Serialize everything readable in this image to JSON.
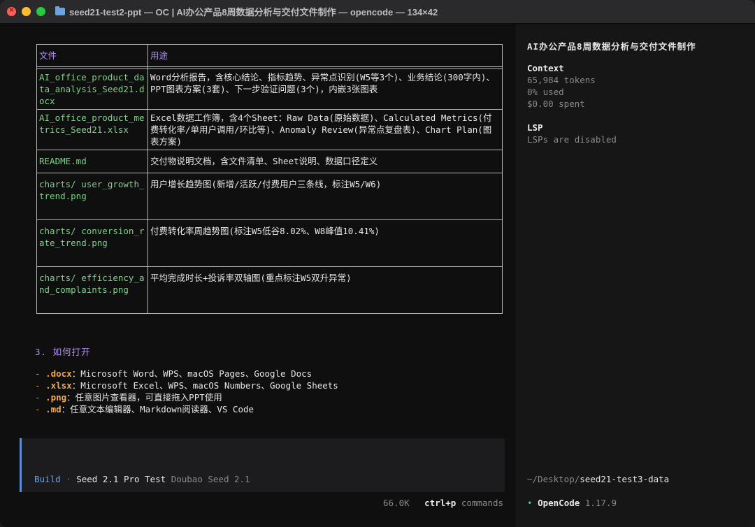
{
  "window": {
    "title": "seed21-test2-ppt — OC | AI办公产品8周数据分析与交付文件制作 — opencode — 134×42"
  },
  "table": {
    "headers": [
      "文件",
      "用途"
    ],
    "rows": [
      {
        "file": "AI_office_product_data_analysis_Seed21.docx",
        "purpose": "Word分析报告，含核心结论、指标趋势、异常点识别(W5等3个)、业务结论(300字内)、PPT图表方案(3套)、下一步验证问题(3个)，内嵌3张图表"
      },
      {
        "file": "AI_office_product_metrics_Seed21.xlsx",
        "purpose": "Excel数据工作簿，含4个Sheet：Raw Data(原始数据)、Calculated Metrics(付费转化率/单用户调用/环比等)、Anomaly Review(异常点复盘表)、Chart Plan(图表方案)"
      },
      {
        "file": "README.md",
        "purpose": "交付物说明文档，含文件清单、Sheet说明、数据口径定义"
      },
      {
        "file": "charts/ user_growth_trend.png",
        "purpose": "用户增长趋势图(新增/活跃/付费用户三条线，标注W5/W6)"
      },
      {
        "file": "charts/ conversion_rate_trend.png",
        "purpose": "付费转化率周趋势图(标注W5低谷8.02%、W8峰值10.41%)"
      },
      {
        "file": "charts/ efficiency_and_complaints.png",
        "purpose": "平均完成时长+投诉率双轴图(重点标注W5双升异常)"
      }
    ]
  },
  "section": {
    "heading": "3. 如何打开"
  },
  "open_list": [
    {
      "dash": "-",
      "ext": ".docx",
      "text": "：Microsoft Word、WPS、macOS Pages、Google Docs"
    },
    {
      "dash": "-",
      "ext": ".xlsx",
      "text": "：Microsoft Excel、WPS、macOS Numbers、Google Sheets"
    },
    {
      "dash": "-",
      "ext": ".png",
      "text": "：任意图片查看器，可直接拖入PPT使用"
    },
    {
      "dash": "-",
      "ext": ".md",
      "text": "：任意文本编辑器、Markdown阅读器、VS Code"
    }
  ],
  "status": {
    "mode": "Build",
    "separator": "·",
    "model": "Seed 2.1 Pro Test",
    "provider": "Doubao Seed 2.1",
    "tokens": "66.0K",
    "shortcut": "ctrl+p",
    "shortcut_label": "commands"
  },
  "sidebar": {
    "title": "AI办公产品8周数据分析与交付文件制作",
    "context_heading": "Context",
    "context_tokens": "65,984 tokens",
    "context_used": "0% used",
    "context_spent": "$0.00 spent",
    "lsp_heading": "LSP",
    "lsp_status": "LSPs are disabled",
    "path_prefix": "~/Desktop/",
    "path_dir": "seed21-test3-data",
    "version_dot": "•",
    "app_name": "OpenCode",
    "version": "1.17.9"
  },
  "colors": {
    "accent_purple": "#b48ef5",
    "file_green": "#7fd18a",
    "ext_orange": "#f0a94e",
    "build_blue": "#6aa4de"
  }
}
